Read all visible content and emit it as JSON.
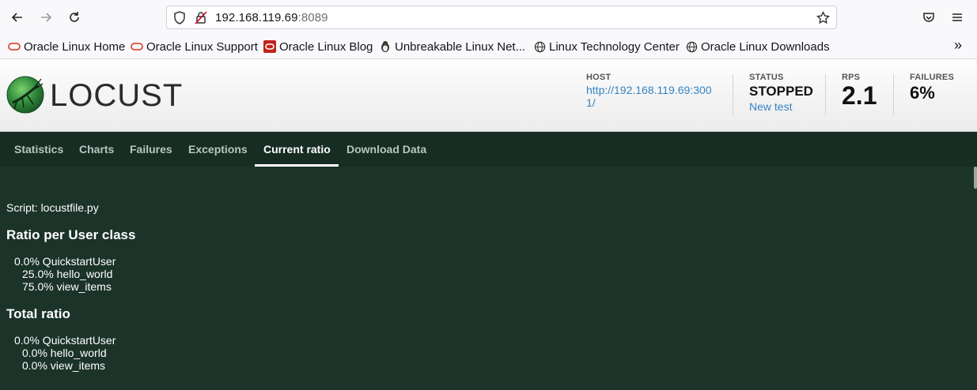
{
  "browser": {
    "url_host": "192.168.119.69",
    "url_port": ":8089",
    "icons": [
      "back-icon",
      "forward-icon",
      "reload-icon",
      "shield-icon",
      "insecure-lock-icon",
      "star-icon",
      "pocket-icon",
      "menu-icon"
    ],
    "bookmarks": [
      {
        "label": "Oracle Linux Home",
        "icon": "oracle-icon"
      },
      {
        "label": "Oracle Linux Support",
        "icon": "oracle-icon"
      },
      {
        "label": "Oracle Linux Blog",
        "icon": "oracle-blog-icon"
      },
      {
        "label": "Unbreakable Linux Net...",
        "icon": "penguin-icon"
      },
      {
        "label": "Linux Technology Center",
        "icon": "globe-icon"
      },
      {
        "label": "Oracle Linux Downloads",
        "icon": "globe-icon"
      }
    ],
    "overflow": "»"
  },
  "header": {
    "logo_text": "LOCUST",
    "host_label": "HOST",
    "host_value": "http://192.168.119.69:3001/",
    "status_label": "STATUS",
    "status_value": "STOPPED",
    "new_test": "New test",
    "rps_label": "RPS",
    "rps_value": "2.1",
    "failures_label": "FAILURES",
    "failures_value": "6%"
  },
  "tabs": [
    {
      "label": "Statistics",
      "active": false
    },
    {
      "label": "Charts",
      "active": false
    },
    {
      "label": "Failures",
      "active": false
    },
    {
      "label": "Exceptions",
      "active": false
    },
    {
      "label": "Current ratio",
      "active": true
    },
    {
      "label": "Download Data",
      "active": false
    }
  ],
  "content": {
    "script": "Script: locustfile.py",
    "ratio_title": "Ratio per User class",
    "ratio_lines": [
      "0.0% QuickstartUser",
      "25.0% hello_world",
      "75.0% view_items"
    ],
    "total_title": "Total ratio",
    "total_lines": [
      "0.0% QuickstartUser",
      "0.0% hello_world",
      "0.0% view_items"
    ]
  },
  "colors": {
    "content_bg": "#1b3329",
    "tabs_bg": "#172d24",
    "link": "#3484c4"
  }
}
